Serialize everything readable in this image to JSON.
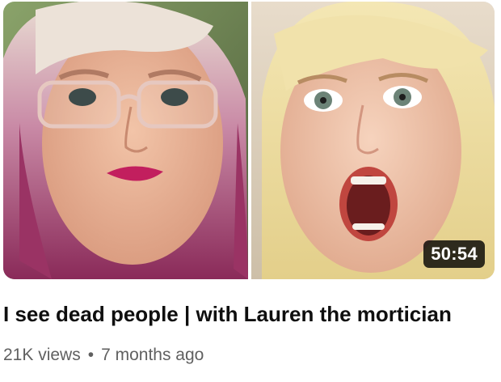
{
  "video": {
    "duration": "50:54",
    "title": "I see dead people | with Lauren the mortician",
    "views": "21K views",
    "separator": "•",
    "age": "7 months ago"
  },
  "colors": {
    "title": "#0f0f0f",
    "meta": "#606060",
    "duration_bg": "#000000cc",
    "duration_text": "#ffffff"
  }
}
